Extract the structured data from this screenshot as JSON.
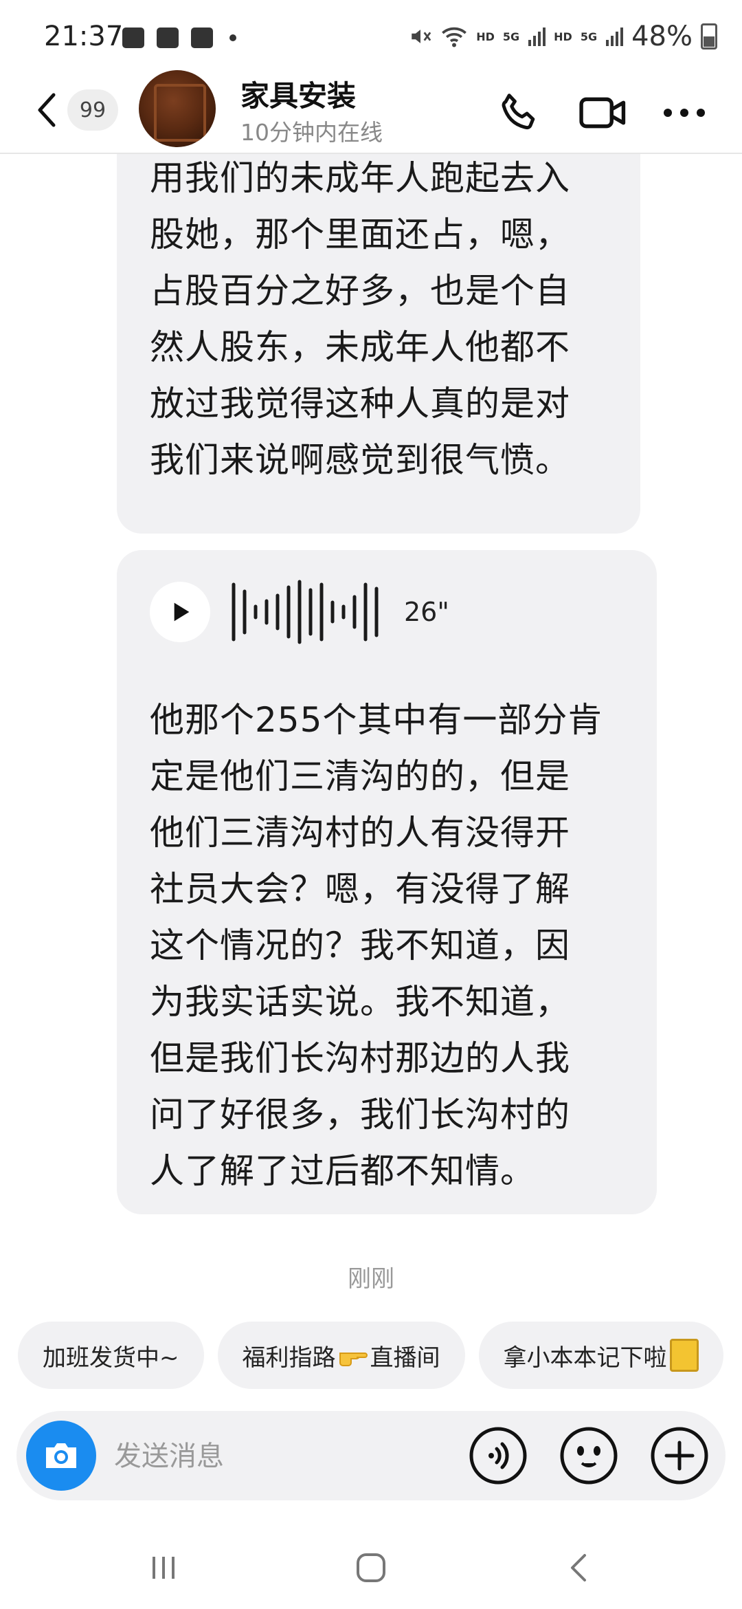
{
  "status_bar": {
    "time": "21:37",
    "network_labels": [
      "HD",
      "5G",
      "HD",
      "5G"
    ],
    "battery": "48%",
    "battery_level": 0.48
  },
  "header": {
    "unread_count": "99",
    "contact_name": "家具安装",
    "contact_status": "10分钟内在线"
  },
  "messages": [
    {
      "type": "text",
      "text": "们的女还是个未成年人，她\n用我们的未成年人跑起去入\n股她，那个里面还占，嗯，\n占股百分之好多，也是个自\n然人股东，未成年人他都不\n放过我觉得这种人真的是对\n我们来说啊感觉到很气愤。"
    },
    {
      "type": "voice",
      "duration": "26\"",
      "transcript": "他那个255个其中有一部分肯\n定是他们三清沟的的，但是\n他们三清沟村的人有没得开\n社员大会？嗯，有没得了解\n这个情况的？我不知道，因\n为我实话实说。我不知道，\n但是我们长沟村那边的人我\n问了好很多，我们长沟村的\n人了解了过后都不知情。"
    }
  ],
  "timestamp": "刚刚",
  "quick_replies": [
    {
      "label": "加班发货中~"
    },
    {
      "label_before": "福利指路",
      "label_after": "直播间"
    },
    {
      "label": "拿小本本记下啦"
    }
  ],
  "input": {
    "placeholder": "发送消息"
  },
  "colors": {
    "accent": "#1a8cf0",
    "bubble": "#f1f1f3",
    "muted_text": "#888888"
  },
  "icons": [
    "back-icon",
    "phone-icon",
    "video-icon",
    "more-icon",
    "play-icon",
    "camera-icon",
    "voice-input-icon",
    "emoji-icon",
    "plus-icon",
    "recents-icon",
    "home-icon",
    "nav-back-icon"
  ]
}
